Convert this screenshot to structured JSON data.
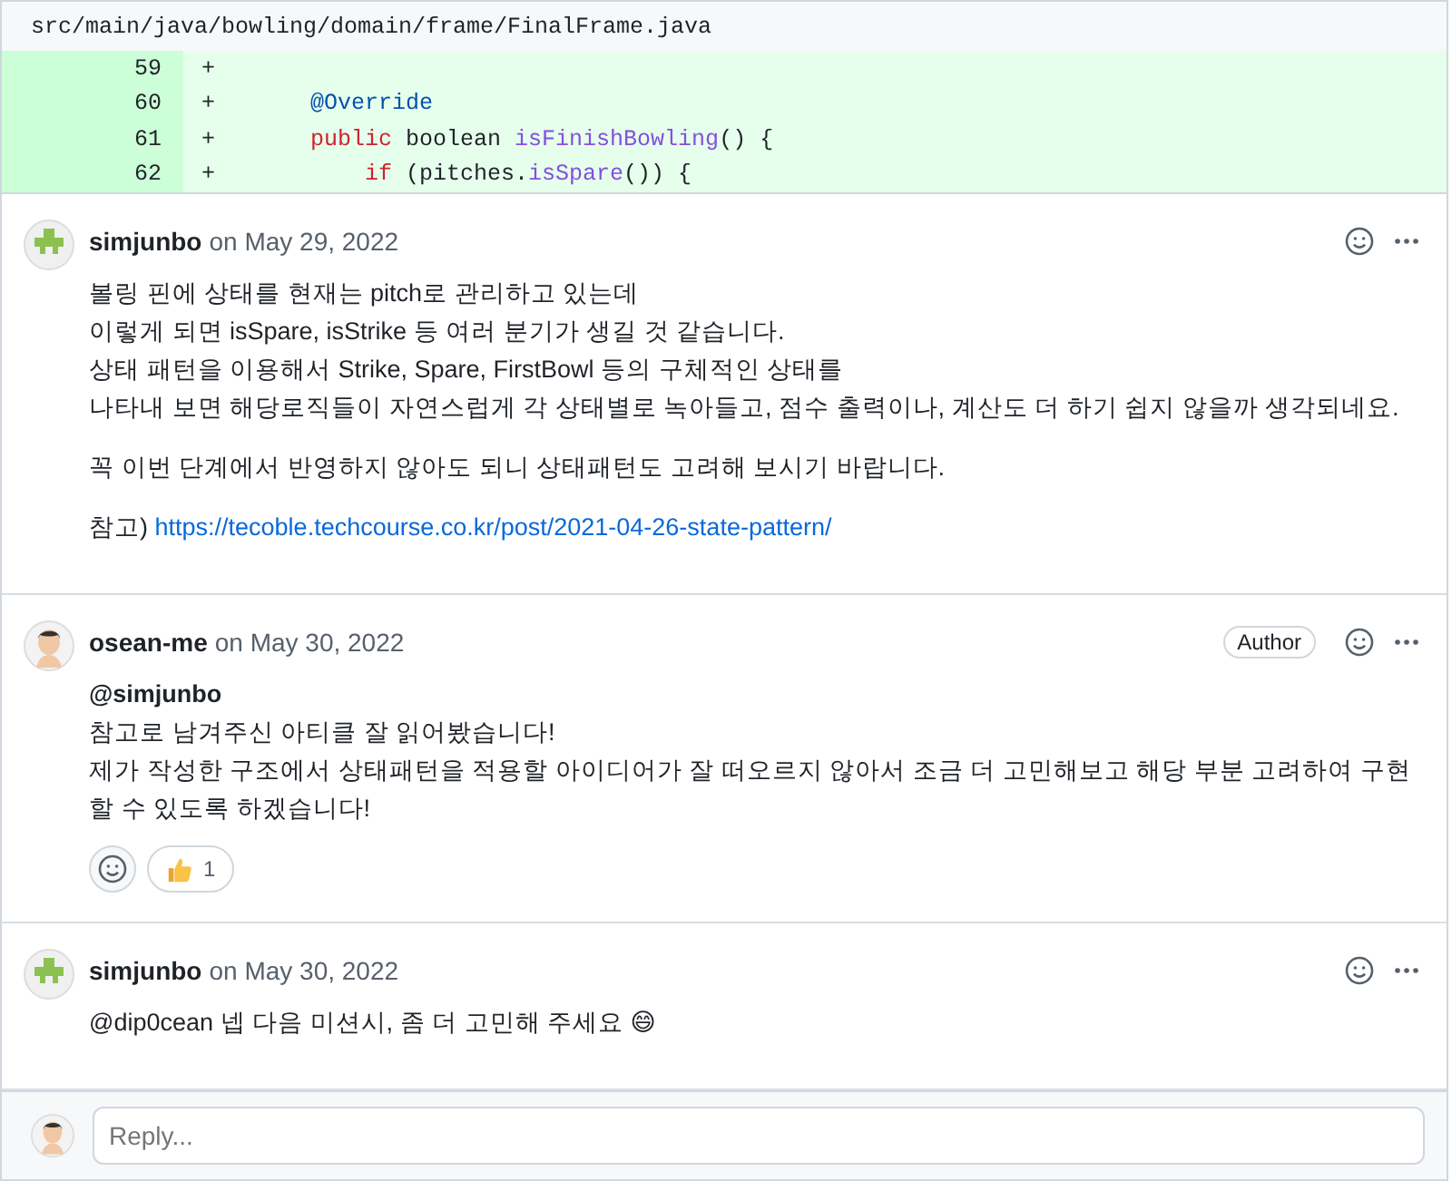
{
  "file": {
    "path": "src/main/java/bowling/domain/frame/FinalFrame.java",
    "lines": [
      {
        "number": "59",
        "sign": "+"
      },
      {
        "number": "60",
        "sign": "+",
        "tokens": [
          {
            "kind": "annotation",
            "text": "@Override"
          }
        ]
      },
      {
        "number": "61",
        "sign": "+",
        "tokens": [
          {
            "kind": "keyword",
            "text": "public"
          },
          {
            "kind": "plain",
            "text": " boolean "
          },
          {
            "kind": "method",
            "text": "isFinishBowling"
          },
          {
            "kind": "plain",
            "text": "() {"
          }
        ],
        "children": [
          {
            "number": "62",
            "sign": "+",
            "tokens": [
              {
                "kind": "keyword",
                "text": "if"
              },
              {
                "kind": "plain",
                "text": " (pitches."
              },
              {
                "kind": "method",
                "text": "isSpare"
              },
              {
                "kind": "plain",
                "text": "()) {"
              }
            ]
          }
        ]
      }
    ]
  },
  "comments": [
    {
      "author": "simjunbo",
      "avatar": {
        "kind": "identicon"
      },
      "date": "on May 29, 2022",
      "blocks": [
        {
          "kind": "text",
          "lines": [
            "볼링 핀에 상태를 현재는 pitch로 관리하고 있는데",
            "이렇게 되면 isSpare, isStrike 등 여러 분기가 생길 것 같습니다.",
            "상태 패턴을 이용해서 Strike, Spare, FirstBowl 등의 구체적인 상태를",
            "나타내 보면 해당로직들이 자연스럽게 각 상태별로 녹아들고, 점수 출력이나, 계산도 더 하기 쉽지 않을까 생각되네요."
          ]
        },
        {
          "kind": "text",
          "lines": [
            "꼭 이번 단계에서 반영하지 않아도 되니 상태패턴도 고려해 보시기 바랍니다."
          ]
        },
        {
          "kind": "link",
          "prefix": "참고)",
          "url": "https://tecoble.techcourse.co.kr/post/2021-04-26-state-pattern/"
        }
      ]
    },
    {
      "author": "osean-me",
      "avatar": {
        "kind": "portrait"
      },
      "date": "on May 30, 2022",
      "badge": "Author",
      "blocks": [
        {
          "kind": "mention",
          "text": "@simjunbo"
        },
        {
          "kind": "text",
          "lines": [
            "참고로 남겨주신 아티클 잘 읽어봤습니다!",
            "제가 작성한 구조에서 상태패턴을 적용할 아이디어가 잘 떠오르지 않아서 조금 더 고민해보고 해당 부분 고려하여 구현할 수 있도록 하겠습니다!"
          ]
        }
      ],
      "reactions": [
        {
          "count": "1"
        }
      ]
    },
    {
      "author": "simjunbo",
      "avatar": {
        "kind": "identicon"
      },
      "date": "on May 30, 2022",
      "blocks": [
        {
          "kind": "text",
          "lines": [
            "@dip0cean 넵 다음 미션시, 좀 더 고민해 주세요 😄"
          ]
        }
      ]
    }
  ],
  "reply": {
    "placeholder": "Reply..."
  }
}
